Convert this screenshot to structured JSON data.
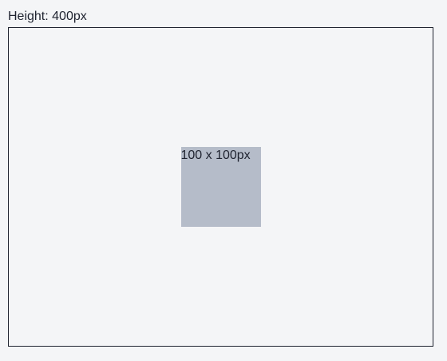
{
  "header": {
    "height_label": "Height: 400px"
  },
  "container": {
    "box_label": "100 x 100px"
  },
  "colors": {
    "background": "#f4f5f7",
    "box": "#b5bcc9",
    "border": "#1f2330",
    "text": "#1f2330"
  }
}
